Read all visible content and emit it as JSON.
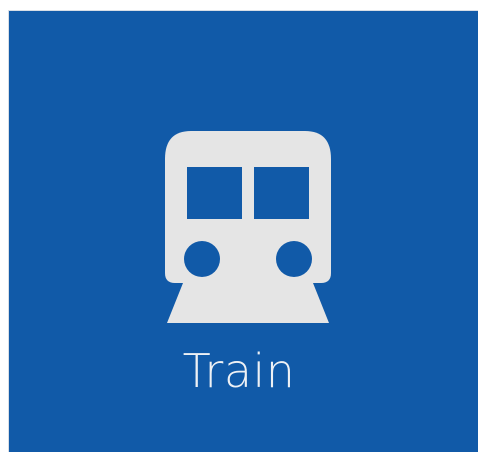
{
  "tile": {
    "label": "Train",
    "icon": "train-icon",
    "background_color": "#115aa8",
    "icon_color": "#e5e5e5"
  }
}
